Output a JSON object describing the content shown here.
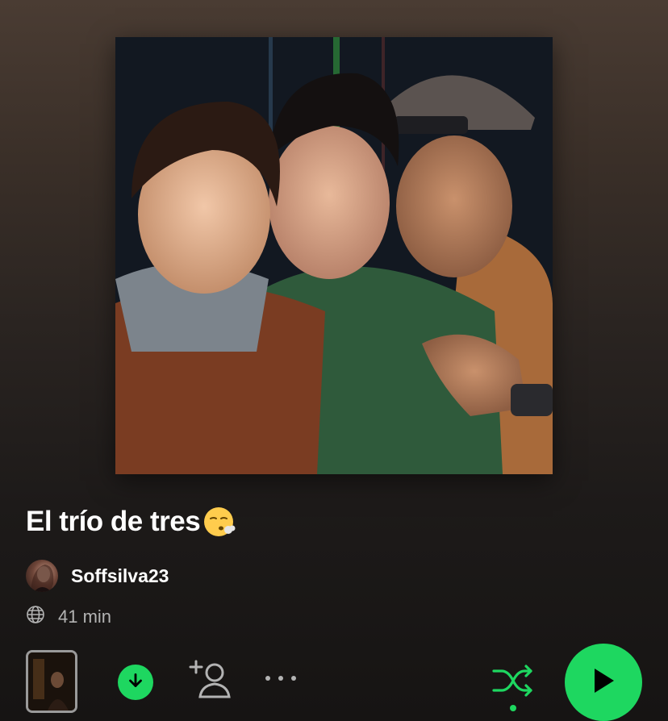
{
  "playlist": {
    "title": "El trío de tres",
    "owner": "Soffsilva23",
    "duration": "41 min"
  },
  "icons": {
    "visibility": "globe-icon",
    "download": "download-icon",
    "add_user": "add-user-icon",
    "more": "more-icon",
    "shuffle": "shuffle-icon",
    "play": "play-icon"
  },
  "colors": {
    "accent": "#1ed760",
    "text_secondary": "#b3b3b3"
  }
}
